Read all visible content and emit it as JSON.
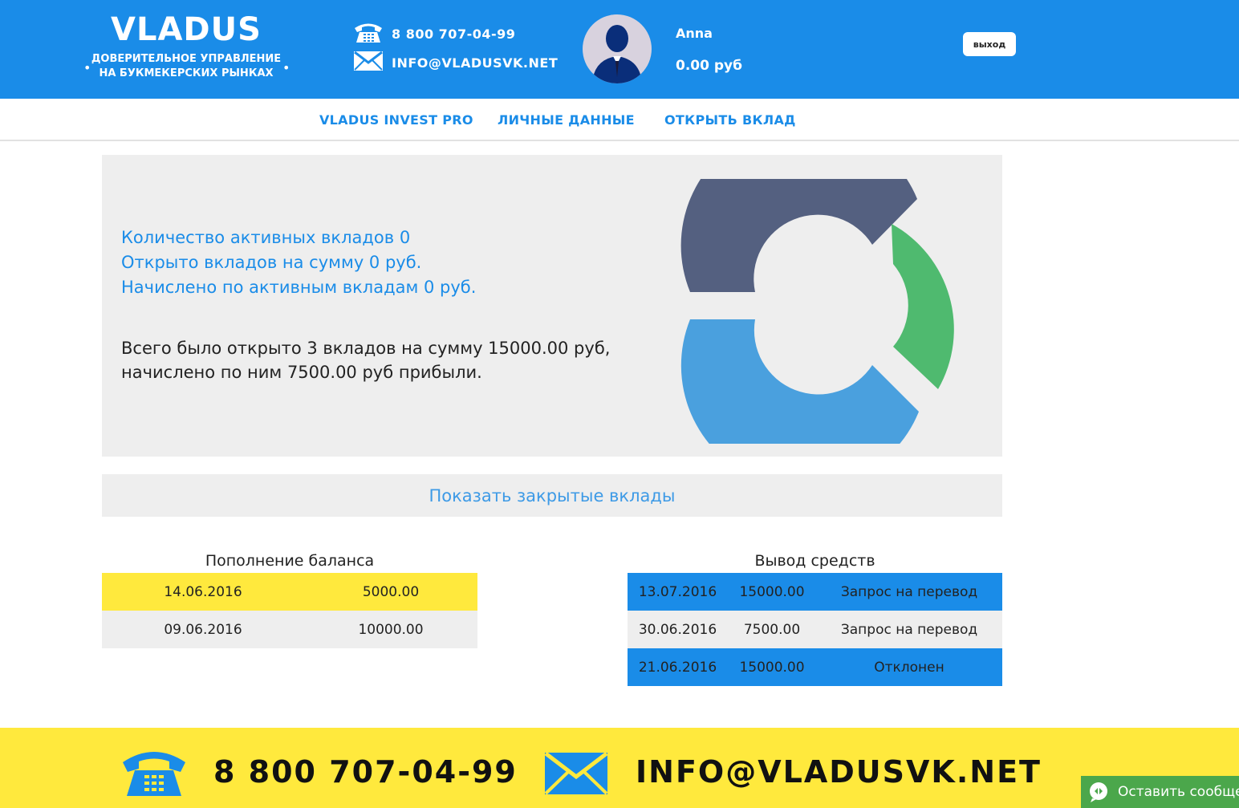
{
  "header": {
    "logo_title": "VLADUS",
    "logo_subtitle_line1": "ДОВЕРИТЕЛЬНОЕ УПРАВЛЕНИЕ",
    "logo_subtitle_line2": "НА БУКМЕКЕРСКИХ РЫНКАХ",
    "phone": "8 800 707-04-99",
    "email": "INFO@VLADUSVK.NET",
    "user_name": "Anna",
    "user_balance": "0.00 руб",
    "logout_label": "выход",
    "background_color": "#1a8ce8"
  },
  "nav": {
    "items": [
      {
        "label": "VLADUS INVEST PRO"
      },
      {
        "label": "ЛИЧНЫЕ ДАННЫЕ"
      },
      {
        "label": "ОТКРЫТЬ ВКЛАД"
      }
    ]
  },
  "stats": {
    "active_count": "Количество активных вкладов 0",
    "open_sum": "Открыто вкладов на сумму 0 руб.",
    "accrued": "Начислено по активным вкладам 0 руб.",
    "summary_line1": "Всего было открыто 3 вкладов на сумму 15000.00 руб,",
    "summary_line2": "начислено по ним 7500.00 руб прибыли.",
    "donut_segments": [
      {
        "color": "#546080"
      },
      {
        "color": "#4fba6f"
      },
      {
        "color": "#4aa0de"
      }
    ]
  },
  "show_closed_label": "Показать закрытые вклады",
  "deposits": {
    "title": "Пополнение баланса",
    "rows": [
      {
        "date": "14.06.2016",
        "amount": "5000.00",
        "color": "#ffe93d"
      },
      {
        "date": "09.06.2016",
        "amount": "10000.00",
        "color": "#eeeeee"
      }
    ]
  },
  "withdrawals": {
    "title": "Вывод средств",
    "rows": [
      {
        "date": "13.07.2016",
        "amount": "15000.00",
        "status": "Запрос на перевод",
        "color": "#1a8ce8"
      },
      {
        "date": "30.06.2016",
        "amount": "7500.00",
        "status": "Запрос на перевод",
        "color": "#eeeeee"
      },
      {
        "date": "21.06.2016",
        "amount": "15000.00",
        "status": "Отклонен",
        "color": "#1a8ce8"
      }
    ]
  },
  "footer": {
    "phone": "8 800 707-04-99",
    "email": "INFO@VLADUSVK.NET",
    "chat_label": "Оставить сообщение",
    "background_color": "#ffe93d"
  },
  "icons": {
    "phone": "phone-icon",
    "mail": "mail-icon",
    "avatar": "user-silhouette-icon",
    "chat": "chat-bubble-icon"
  }
}
